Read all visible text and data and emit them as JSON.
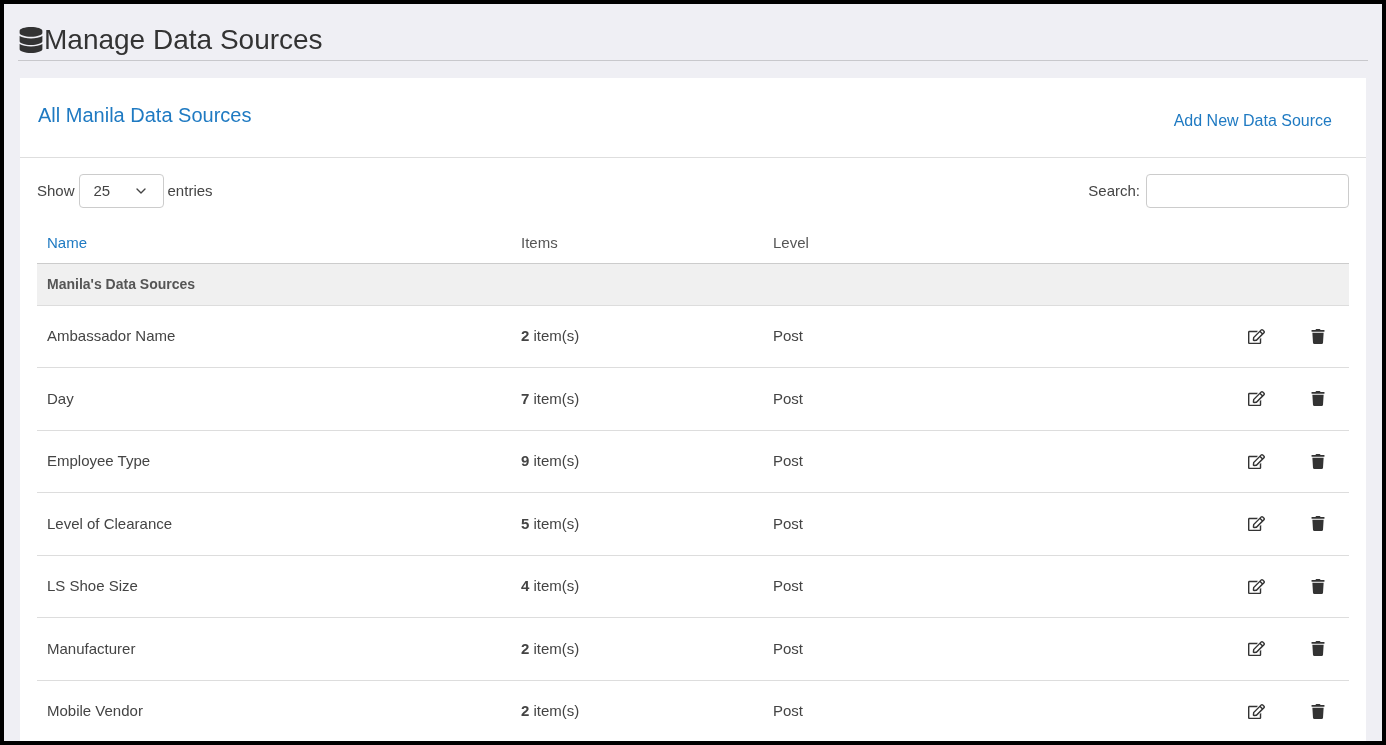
{
  "page_title": "Manage Data Sources",
  "card": {
    "title": "All Manila Data Sources",
    "add_link": "Add New Data Source"
  },
  "length_control": {
    "before": "Show",
    "value": "25",
    "after": "entries"
  },
  "search": {
    "label": "Search:"
  },
  "table": {
    "columns": [
      {
        "label": "Name",
        "sortable": true
      },
      {
        "label": "Items",
        "sortable": false
      },
      {
        "label": "Level",
        "sortable": false
      }
    ],
    "group": "Manila's Data Sources",
    "rows": [
      {
        "name": "Ambassador Name",
        "items": "**2** item(s)",
        "level": "Post"
      },
      {
        "name": "Day",
        "items": "**7** item(s)",
        "level": "Post"
      },
      {
        "name": "Employee Type",
        "items": "**9** item(s)",
        "level": "Post"
      },
      {
        "name": "Level of Clearance",
        "items": "**5** item(s)",
        "level": "Post"
      },
      {
        "name": "LS Shoe Size",
        "items": "**4** item(s)",
        "level": "Post"
      },
      {
        "name": "Manufacturer",
        "items": "**2** item(s)",
        "level": "Post"
      },
      {
        "name": "Mobile Vendor",
        "items": "**2** item(s)",
        "level": "Post"
      }
    ]
  }
}
